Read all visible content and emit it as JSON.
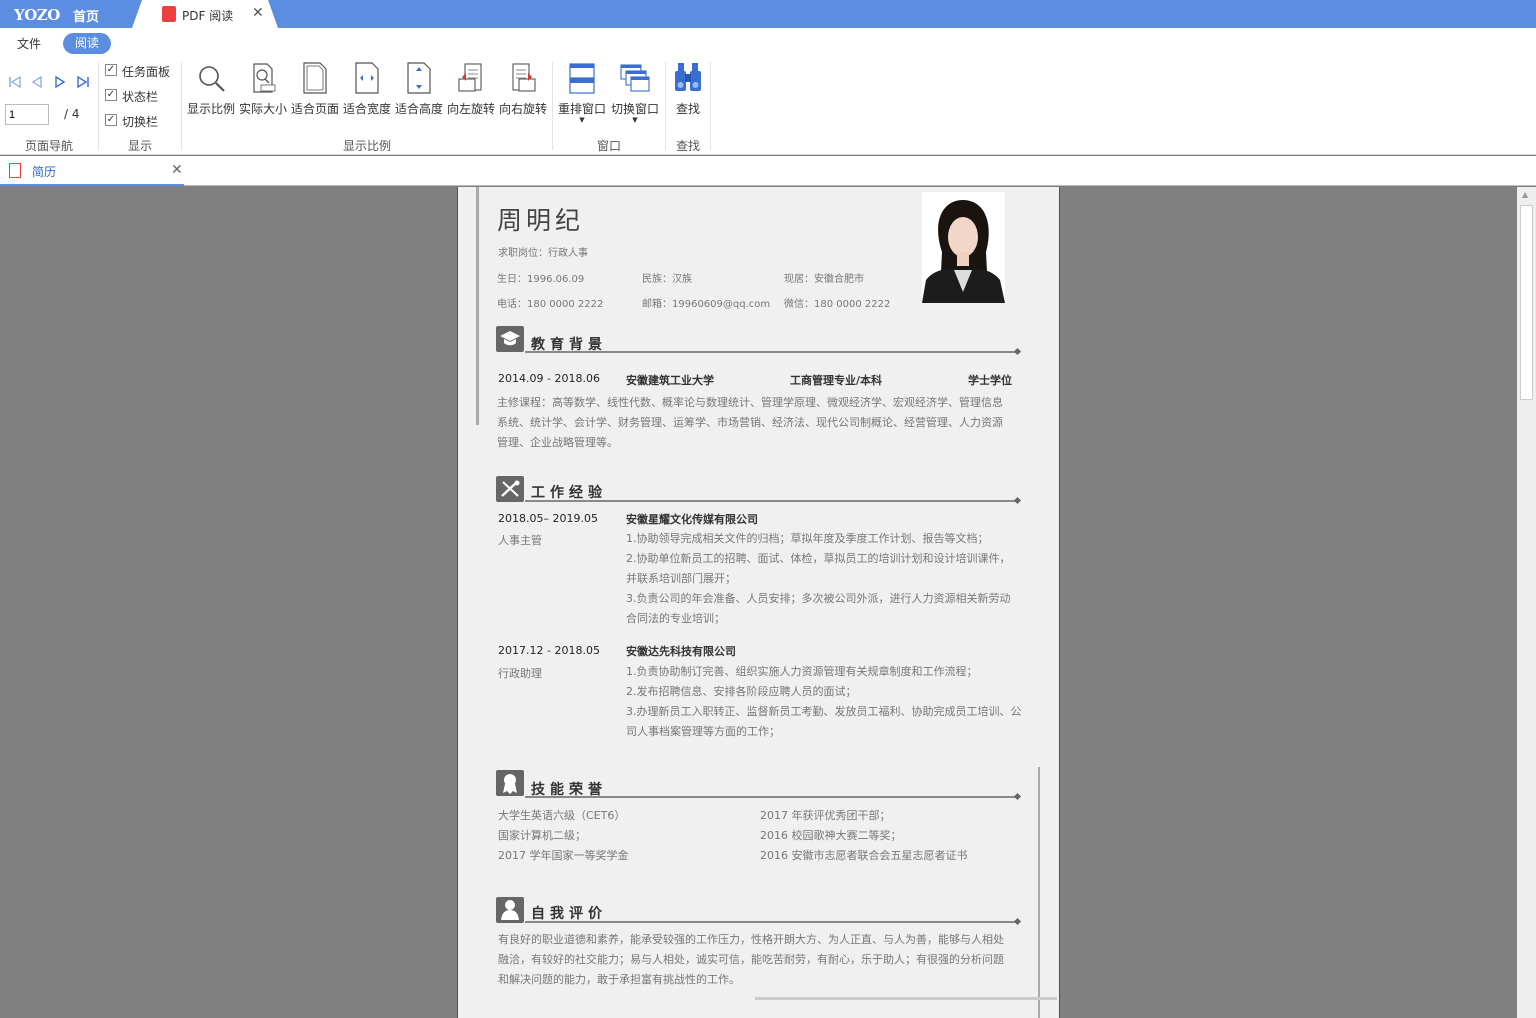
{
  "titlebar": {
    "logo": "YOZO",
    "home": "首页",
    "tab_label": "PDF 阅读"
  },
  "menu": {
    "file": "文件",
    "read": "阅读"
  },
  "ribbon": {
    "page_nav": {
      "current": "1",
      "total": "/ 4",
      "label": "页面导航"
    },
    "display": {
      "items": [
        "任务面板",
        "状态栏",
        "切换栏"
      ],
      "label": "显示"
    },
    "zoom": {
      "buttons": [
        "显示比例",
        "实际大小",
        "适合页面",
        "适合宽度",
        "适合高度",
        "向左旋转",
        "向右旋转"
      ],
      "label": "显示比例"
    },
    "window": {
      "buttons": [
        "重排窗口",
        "切换窗口"
      ],
      "label": "窗口"
    },
    "find": {
      "button": "查找",
      "label": "查找"
    }
  },
  "doc_tab": {
    "label": "简历"
  },
  "resume": {
    "name": "周明纪",
    "position": "求职岗位：行政人事",
    "birth": "生日：1996.06.09",
    "ethnicity": "民族：汉族",
    "residence": "现居：安徽合肥市",
    "phone": "电话：180 0000 2222",
    "email": "邮箱：19960609@qq.com",
    "wechat": "微信：180 0000 2222",
    "edu": {
      "title": "教育背景",
      "period": "2014.09 - 2018.06",
      "school": "安徽建筑工业大学",
      "major": "工商管理专业/本科",
      "degree": "学士学位",
      "courses": [
        "主修课程：高等数学、线性代数、概率论与数理统计、管理学原理、微观经济学、宏观经济学、管理信息",
        "系统、统计学、会计学、财务管理、运筹学、市场营销、经济法、现代公司制概论、经营管理、人力资源",
        "管理、企业战略管理等。"
      ]
    },
    "work": {
      "title": "工作经验",
      "jobs": [
        {
          "period": "2018.05– 2019.05",
          "role": "人事主管",
          "company": "安徽星耀文化传媒有限公司",
          "lines": [
            "1.协助领导完成相关文件的归档；草拟年度及季度工作计划、报告等文档；",
            "2.协助单位新员工的招聘、面试、体检，草拟员工的培训计划和设计培训课件，",
            "并联系培训部门展开；",
            "3.负责公司的年会准备、人员安排；多次被公司外派，进行人力资源相关新劳动",
            "合同法的专业培训；"
          ]
        },
        {
          "period": "2017.12 - 2018.05",
          "role": "行政助理",
          "company": "安徽达先科技有限公司",
          "lines": [
            "1.负责协助制订完善、组织实施人力资源管理有关规章制度和工作流程；",
            "2.发布招聘信息、安排各阶段应聘人员的面试；",
            "3.办理新员工入职转正、监督新员工考勤、发放员工福利、协助完成员工培训、公",
            "司人事档案管理等方面的工作；"
          ]
        }
      ]
    },
    "skills": {
      "title": "技能荣誉",
      "left": [
        "大学生英语六级（CET6）",
        "国家计算机二级；",
        "2017 学年国家一等奖学金"
      ],
      "right": [
        "2017 年获评优秀团干部；",
        "2016 校园歌神大赛二等奖；",
        "2016 安徽市志愿者联合会五星志愿者证书"
      ]
    },
    "self": {
      "title": "自我评价",
      "lines": [
        "有良好的职业道德和素养，能承受较强的工作压力，性格开朗大方、为人正直、与人为善，能够与人相处",
        "融洽，有较好的社交能力；易与人相处，诚实可信，能吃苦耐劳，有耐心，乐于助人；有很强的分析问题",
        "和解决问题的能力，敢于承担富有挑战性的工作。"
      ]
    }
  }
}
